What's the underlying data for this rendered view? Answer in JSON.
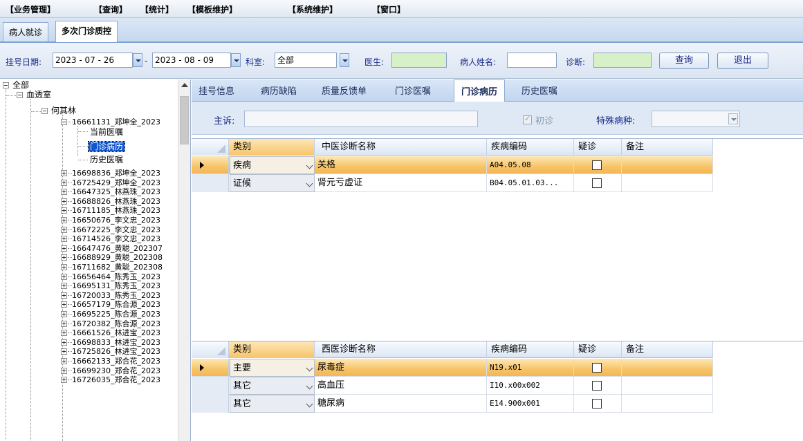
{
  "menu": [
    "【业务管理】",
    "【查询】",
    "【统计】",
    "【模板维护】",
    "【系统维护】",
    "【窗口】"
  ],
  "doc_tabs": [
    {
      "label": "病人就诊",
      "active": false
    },
    {
      "label": "多次门诊质控",
      "active": true
    }
  ],
  "filters": {
    "reg_date_label": "挂号日期:",
    "date_from": "2023 - 07 - 26",
    "date_sep": "-",
    "date_to": "2023 - 08 - 09",
    "dept_label": "科室:",
    "dept_value": "全部",
    "doctor_label": "医生:",
    "patient_label": "病人姓名:",
    "diagnosis_label": "诊断:",
    "query_button": "查询",
    "exit_button": "退出"
  },
  "tree": {
    "root": "全部",
    "dept": "血透室",
    "doctor": "何其林",
    "expanded_record": "16661131_郑坤全_2023",
    "children": [
      "当前医嘱",
      "门诊病历",
      "历史医嘱"
    ],
    "selected_child": "门诊病历",
    "records": [
      "16698836_郑坤全_2023",
      "16725429_郑坤全_2023",
      "16647325_林燕珠_2023",
      "16688826_林燕珠_2023",
      "16711185_林燕珠_2023",
      "16650676_李文忠_2023",
      "16672225_李文忠_2023",
      "16714526_李文忠_2023",
      "16647476_黄聪_202307",
      "16688929_黄聪_202308",
      "16711682_黄聪_202308",
      "16656464_陈秀玉_2023",
      "16695131_陈秀玉_2023",
      "16720033_陈秀玉_2023",
      "16657179_陈合源_2023",
      "16695225_陈合源_2023",
      "16720382_陈合源_2023",
      "16661526_林进宝_2023",
      "16698833_林进宝_2023",
      "16725826_林进宝_2023",
      "16662133_郑合花_2023",
      "16699230_郑合花_2023",
      "16726035_郑合花_2023"
    ]
  },
  "sub_tabs": [
    "挂号信息",
    "病历缺陷",
    "质量反馈单",
    "门诊医嘱",
    "门诊病历",
    "历史医嘱"
  ],
  "active_sub_tab": "门诊病历",
  "complaint": {
    "label": "主诉:",
    "value": "",
    "first_visit_label": "初诊",
    "special_label": "特殊病种:",
    "special_value": ""
  },
  "tcm_grid": {
    "headers": [
      "类别",
      "中医诊断名称",
      "疾病编码",
      "疑诊",
      "备注"
    ],
    "rows": [
      {
        "category": "疾病",
        "name": "关格",
        "code": "A04.05.08",
        "suspected": false,
        "note": "",
        "selected": true
      },
      {
        "category": "证候",
        "name": "肾元亏虚证",
        "code": "B04.05.01.03...",
        "suspected": false,
        "note": "",
        "selected": false
      }
    ]
  },
  "wm_grid": {
    "headers": [
      "类别",
      "西医诊断名称",
      "疾病编码",
      "疑诊",
      "备注"
    ],
    "rows": [
      {
        "category": "主要",
        "name": "尿毒症",
        "code": "N19.x01",
        "suspected": false,
        "note": "",
        "selected": true
      },
      {
        "category": "其它",
        "name": "高血压",
        "code": "I10.x00x002",
        "suspected": false,
        "note": "",
        "selected": false
      },
      {
        "category": "其它",
        "name": "糖尿病",
        "code": "E14.900x001",
        "suspected": false,
        "note": "",
        "selected": false
      }
    ]
  },
  "colors": {
    "selected_row": "#f7c469",
    "accent_blue": "#1155cc",
    "filter_green": "#d8f0c8"
  }
}
